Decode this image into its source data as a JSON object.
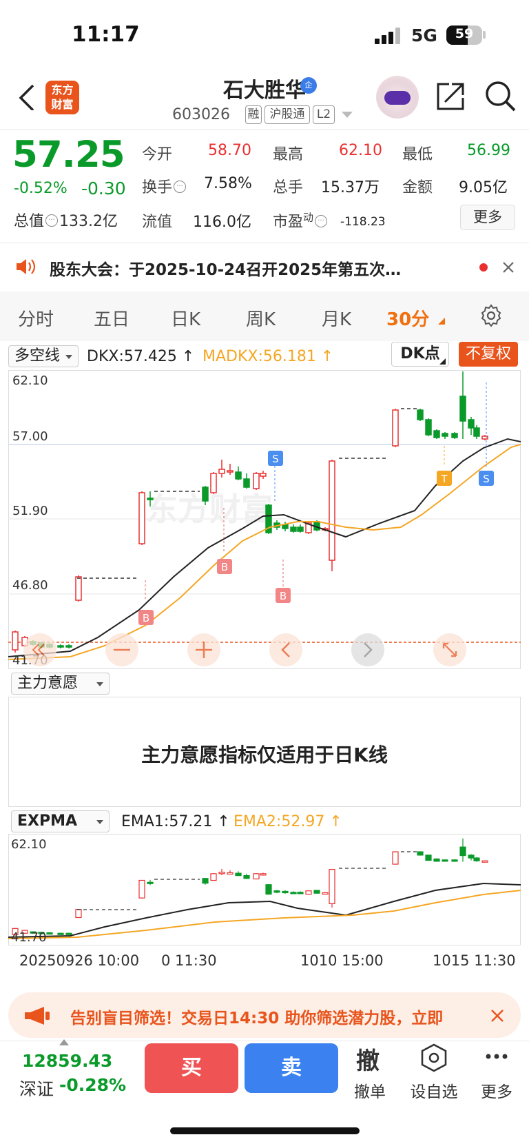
{
  "status_bar": {
    "time": "11:17",
    "network": "5G",
    "battery": "59"
  },
  "header": {
    "logo_line1": "东方",
    "logo_line2": "财富",
    "stock_name": "石大胜华",
    "badge": "企",
    "stock_code": "603026",
    "tags": [
      "融",
      "沪股通",
      "L2"
    ]
  },
  "quote": {
    "price": "57.25",
    "change_pct": "-0.52%",
    "change": "-0.30",
    "total_value_label": "总值",
    "total_value": "133.2亿",
    "open_label": "今开",
    "open": "58.70",
    "high_label": "最高",
    "high": "62.10",
    "low_label": "最低",
    "low": "56.99",
    "turnover_label": "换手",
    "turnover": "7.58%",
    "volume_label": "总手",
    "volume": "15.37万",
    "amount_label": "金额",
    "amount": "9.05亿",
    "float_label": "流值",
    "float_value": "116.0亿",
    "pe_label": "市盈",
    "pe_sup": "动",
    "pe": "-118.23",
    "more": "更多"
  },
  "notice": {
    "text": "股东大会：于2025-10-24召开2025年第五次…"
  },
  "tabs": [
    {
      "label": "分时",
      "active": false
    },
    {
      "label": "五日",
      "active": false
    },
    {
      "label": "日K",
      "active": false
    },
    {
      "label": "周K",
      "active": false
    },
    {
      "label": "月K",
      "active": false
    },
    {
      "label": "30分",
      "active": true
    }
  ],
  "main_chart": {
    "indicator_select": "多空线",
    "dkx_label": "DKX:57.425",
    "madkx_label": "MADKX:56.181",
    "dk_button": "DK点",
    "fuquan_button": "不复权",
    "y_ticks": [
      "62.10",
      "57.00",
      "51.90",
      "46.80",
      "41.70"
    ],
    "signals": [
      "S",
      "B",
      "B",
      "B",
      "T",
      "S"
    ],
    "watermark": "东方财富"
  },
  "sub_panel": {
    "select": "主力意愿",
    "message": "主力意愿指标仅适用于日K线"
  },
  "ema_chart": {
    "select": "EXPMA",
    "ema1_label": "EMA1:57.21",
    "ema2_label": "EMA2:52.97",
    "y_ticks": [
      "62.10",
      "41.70"
    ]
  },
  "x_dates": [
    "20250926 10:00",
    "0 11:30",
    "1010 15:00",
    "1015 11:30"
  ],
  "banner": {
    "text": "告别盲目筛选！交易日14:30 助你筛选潜力股，立即"
  },
  "bottom_bar": {
    "index_value": "12859.43",
    "index_name": "深证",
    "index_change": "-0.28%",
    "buy": "买",
    "sell": "卖",
    "cancel_icon": "撤",
    "cancel": "撤单",
    "watchlist": "设自选",
    "more": "更多"
  },
  "colors": {
    "up": "#e93030",
    "down": "#0a9a2a",
    "accent": "#e8541c",
    "madkx": "#f5a623"
  }
}
